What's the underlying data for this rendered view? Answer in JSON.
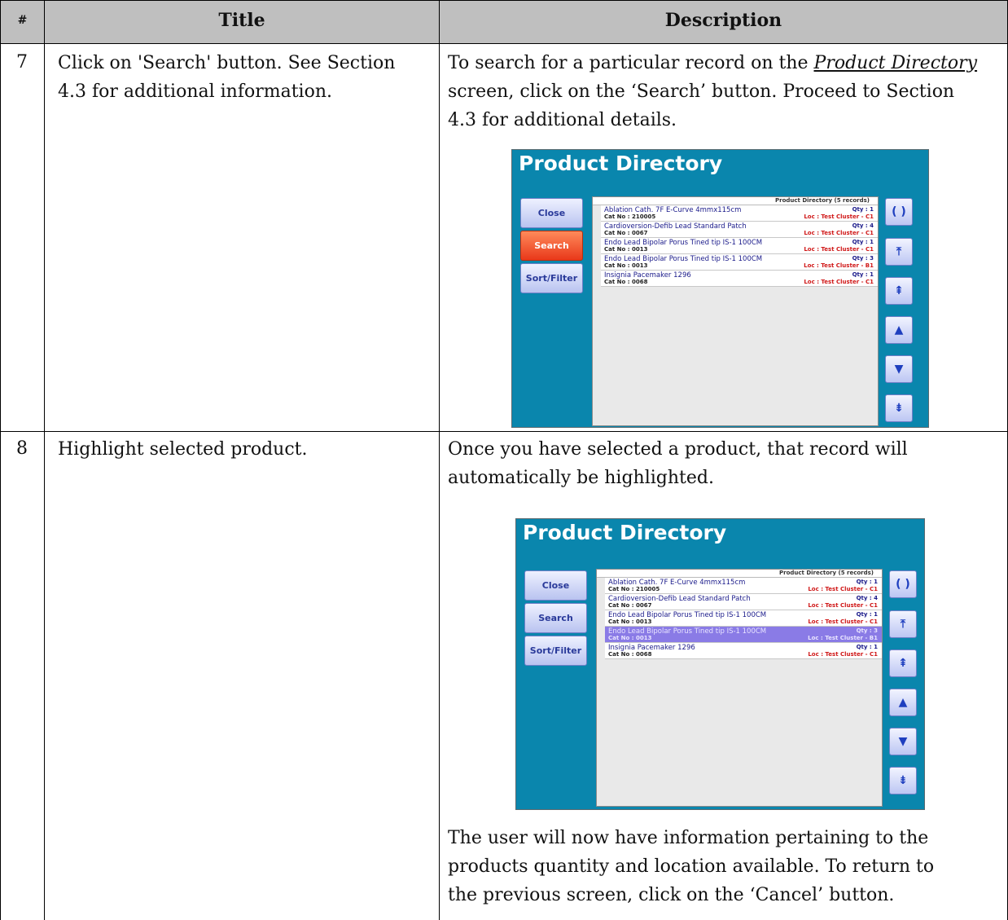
{
  "table": {
    "headers": {
      "num": "#",
      "title": "Title",
      "description": "Description"
    },
    "rows": [
      {
        "num": "7",
        "title_lines": [
          "Click on 'Search' button.  See Section",
          "4.3 for additional information."
        ],
        "desc_line1_pre": "To search for a particular record on the ",
        "desc_line1_link": "Product Directory",
        "desc_line2": "screen, click on the ‘Search’ button.  Proceed to Section",
        "desc_line3": "4.3 for additional details."
      },
      {
        "num": "8",
        "title_lines": [
          "Highlight selected product."
        ],
        "desc_lines": [
          "Once you have selected a product, that record will",
          "automatically be highlighted."
        ],
        "desc_after_lines": [
          "The user will now have information pertaining to the",
          "products quantity and location available.  To return to",
          "the previous screen, click on the ‘Cancel’ button."
        ]
      }
    ]
  },
  "product_directory": {
    "title": "Product Directory",
    "grid_header": "Product Directory (5 records)",
    "buttons": {
      "close": "Close",
      "search": "Search",
      "sort": "Sort/Filter"
    },
    "nav_icons": [
      "refresh-icon",
      "first-icon",
      "page-up-icon",
      "up-icon",
      "down-icon",
      "page-down-icon",
      "last-icon"
    ],
    "nav_glyphs": [
      "( )",
      "⤒",
      "⇞",
      "▲",
      "▼",
      "⇟",
      "⤓"
    ],
    "records": [
      {
        "name": "Ablation Cath. 7F E-Curve 4mmx115cm",
        "qty": "Qty : 1",
        "cat": "Cat No : 210005",
        "loc": "Loc : Test Cluster -  C1"
      },
      {
        "name": "Cardioversion-Defib Lead Standard Patch",
        "qty": "Qty : 4",
        "cat": "Cat No : 0067",
        "loc": "Loc : Test Cluster -  C1"
      },
      {
        "name": "Endo Lead Bipolar Porus Tined tip IS-1 100CM",
        "qty": "Qty : 1",
        "cat": "Cat No : 0013",
        "loc": "Loc : Test Cluster -  C1"
      },
      {
        "name": "Endo Lead Bipolar Porus Tined tip IS-1 100CM",
        "qty": "Qty : 3",
        "cat": "Cat No : 0013",
        "loc": "Loc : Test Cluster -  B1"
      },
      {
        "name": "Insignia Pacemaker 1296",
        "qty": "Qty : 1",
        "cat": "Cat No : 0068",
        "loc": "Loc : Test Cluster -  C1"
      }
    ]
  }
}
